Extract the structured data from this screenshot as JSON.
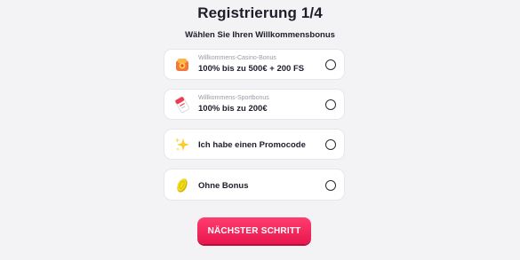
{
  "header": {
    "title": "Registrierung 1/4",
    "subtitle": "Wählen Sie Ihren Willkommensbonus"
  },
  "options": [
    {
      "caption": "Willkommens-Casino-Bonus",
      "label": "100% bis zu 500€ + 200 FS",
      "icon": "casino-chip-icon",
      "selected": false
    },
    {
      "caption": "Willkommens-Sportbonus",
      "label": "100% bis zu 200€",
      "icon": "sport-ticket-icon",
      "selected": false
    },
    {
      "caption": "",
      "label": "Ich habe einen Promocode",
      "icon": "sparkle-icon",
      "selected": false
    },
    {
      "caption": "",
      "label": "Ohne Bonus",
      "icon": "coin-icon",
      "selected": false
    }
  ],
  "actions": {
    "next_label": "NÄCHSTER SCHRITT"
  },
  "colors": {
    "accent": "#f0245a",
    "card_bg": "#ffffff",
    "page_bg": "#f3f3f5"
  }
}
